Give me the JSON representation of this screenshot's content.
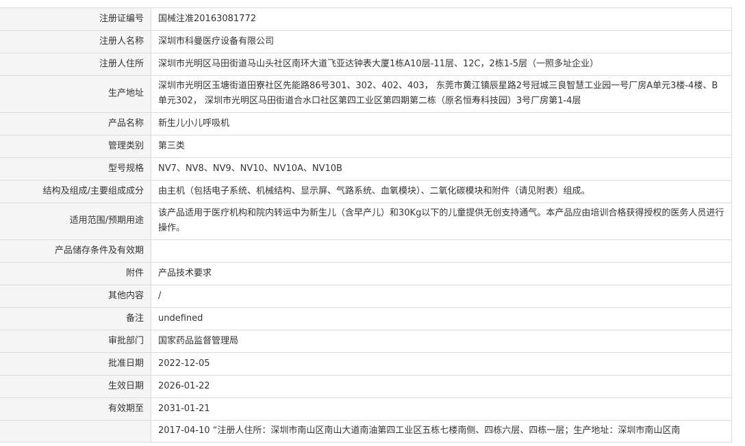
{
  "rows": [
    {
      "label": "注册证编号",
      "value": "国械注准20163081772"
    },
    {
      "label": "注册人名称",
      "value": "深圳市科曼医疗设备有限公司"
    },
    {
      "label": "注册人住所",
      "value": "深圳市光明区马田街道马山头社区南环大道飞亚达钟表大厦1栋A10层-11层、12C，2栋1-5层（一照多址企业）"
    },
    {
      "label": "生产地址",
      "value": "深圳市光明区玉塘街道田寮社区先能路86号301、302、402、403， 东莞市黄江镇辰星路2号冠城三良智慧工业园一号厂房A单元3楼-4楼、B单元302， 深圳市光明区马田街道合水口社区第四工业区第四期第二栋（原名恒寿科技园）3号厂房第1-4层"
    },
    {
      "label": "产品名称",
      "value": "新生儿小儿呼吸机"
    },
    {
      "label": "管理类别",
      "value": "第三类"
    },
    {
      "label": "型号规格",
      "value": "NV7、NV8、NV9、NV10、NV10A、NV10B"
    },
    {
      "label": "结构及组成/主要组成成分",
      "value": "由主机（包括电子系统、机械结构、显示屏、气路系统、血氧模块）、二氧化碳模块和附件（请见附表）组成。"
    },
    {
      "label": "适用范围/预期用途",
      "value": "该产品适用于医疗机构和院内转运中为新生儿（含早产儿）和30Kg以下的儿童提供无创支持通气。本产品应由培训合格获得授权的医务人员进行操作。"
    },
    {
      "label": "产品储存条件及有效期",
      "value": ""
    },
    {
      "label": "附件",
      "value": "产品技术要求"
    },
    {
      "label": "其他内容",
      "value": "/"
    },
    {
      "label": "备注",
      "value": "undefined"
    },
    {
      "label": "审批部门",
      "value": "国家药品监督管理局"
    },
    {
      "label": "批准日期",
      "value": "2022-12-05"
    },
    {
      "label": "生效日期",
      "value": "2026-01-22"
    },
    {
      "label": "有效期至",
      "value": "2031-01-21"
    },
    {
      "label": "",
      "value": "2017-04-10 “注册人住所：深圳市南山区南山大道南油第四工业区五栋七楼南侧、四栋六层、四栋一层；生产地址：深圳市南山区南"
    }
  ]
}
